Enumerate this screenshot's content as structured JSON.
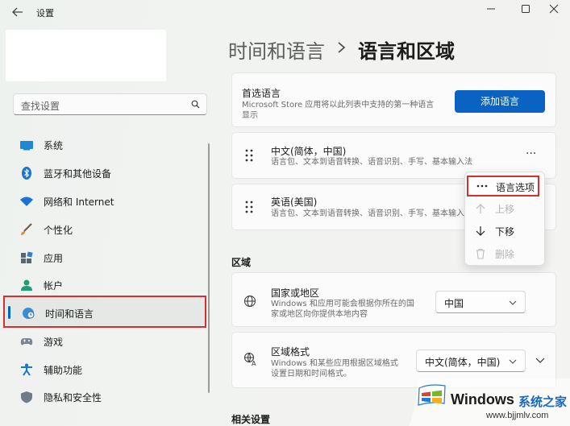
{
  "titlebar": {
    "title": "设置"
  },
  "sidebar": {
    "search_placeholder": "查找设置",
    "items": [
      {
        "label": "系统",
        "icon": "monitor-icon"
      },
      {
        "label": "蓝牙和其他设备",
        "icon": "bluetooth-icon"
      },
      {
        "label": "网络和 Internet",
        "icon": "wifi-icon"
      },
      {
        "label": "个性化",
        "icon": "brush-icon"
      },
      {
        "label": "应用",
        "icon": "apps-icon"
      },
      {
        "label": "帐户",
        "icon": "person-icon"
      },
      {
        "label": "时间和语言",
        "icon": "globe-clock-icon",
        "selected": true
      },
      {
        "label": "游戏",
        "icon": "gamepad-icon"
      },
      {
        "label": "辅助功能",
        "icon": "accessibility-icon"
      },
      {
        "label": "隐私和安全性",
        "icon": "shield-icon"
      }
    ]
  },
  "header": {
    "parent": "时间和语言",
    "separator": "›",
    "current": "语言和区域"
  },
  "preferred": {
    "title": "首选语言",
    "desc_line1": "Microsoft Store 应用将以此列表中支持的第一种语言",
    "desc_line2": "显示",
    "add_button": "添加语言"
  },
  "languages": [
    {
      "name": "中文(简体，中国)",
      "desc": "语言包、文本到语音转换、语音识别、手写、基本输入法"
    },
    {
      "name": "英语(美国)",
      "desc": "语言包、文本到语音转换、语音识别、手写、基本输入法"
    }
  ],
  "more_glyph": "···",
  "context_menu": {
    "items": [
      {
        "label": "语言选项",
        "icon": "more-icon",
        "enabled": true
      },
      {
        "label": "上移",
        "icon": "arrow-up-icon",
        "enabled": false
      },
      {
        "label": "下移",
        "icon": "arrow-down-icon",
        "enabled": true
      },
      {
        "label": "删除",
        "icon": "trash-icon",
        "enabled": false
      }
    ]
  },
  "region": {
    "section_title": "区域",
    "country": {
      "title": "国家或地区",
      "desc_line1": "Windows 和应用可能会根据你所在的国",
      "desc_line2": "家或地区向你提供本地内容",
      "value": "中国"
    },
    "format": {
      "title": "区域格式",
      "desc_line1": "Windows 和某些应用根据区域格式",
      "desc_line2": "设置日期和时间格式。",
      "value": "中文(简体，中国)"
    }
  },
  "related": {
    "section_title": "相关设置"
  },
  "watermark": {
    "brand": "Windows",
    "site_cn": "系统之家",
    "url": "www.bjjmlv.com"
  },
  "colors": {
    "accent": "#0a62c2",
    "highlight_box": "#d3302f"
  }
}
